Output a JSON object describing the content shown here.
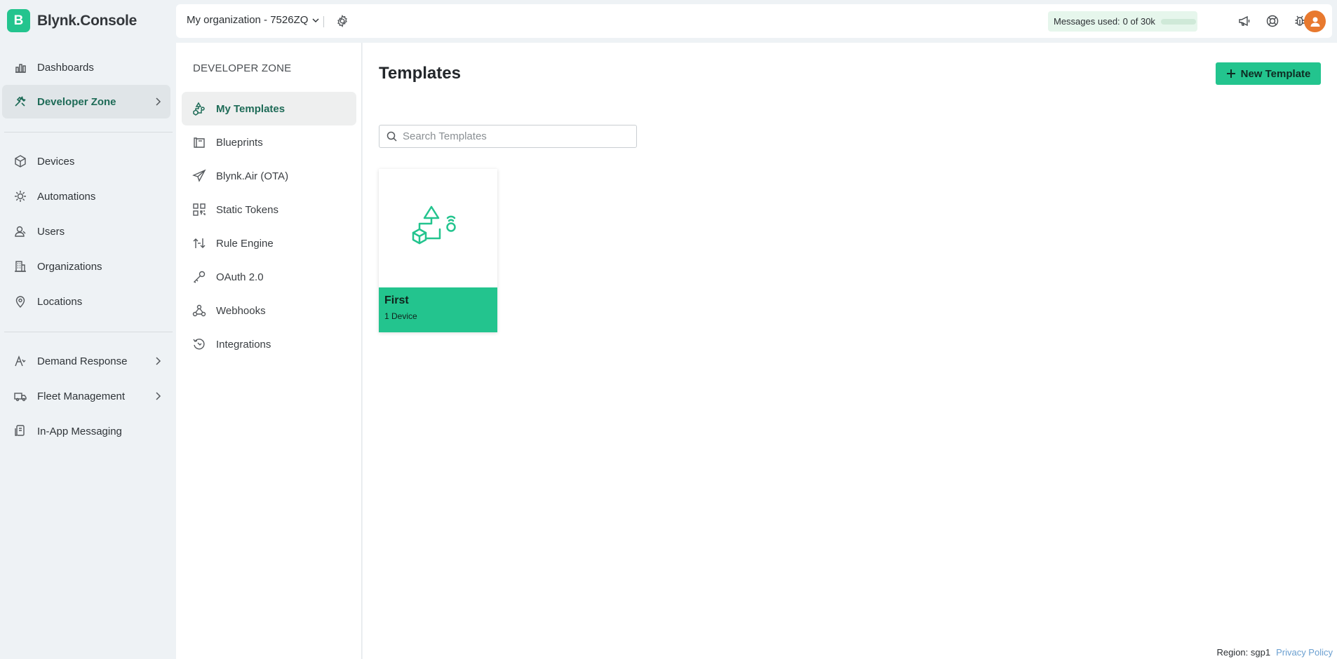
{
  "app": {
    "logo_letter": "B",
    "name": "Blynk.Console",
    "accent": "#23c48e"
  },
  "nav": {
    "dashboards": "Dashboards",
    "developer_zone": "Developer Zone",
    "devices": "Devices",
    "automations": "Automations",
    "users": "Users",
    "organizations": "Organizations",
    "locations": "Locations",
    "demand_response": "Demand Response",
    "fleet_management": "Fleet Management",
    "in_app_messaging": "In-App Messaging"
  },
  "topbar": {
    "org_name": "My organization - 7526ZQ",
    "messages_label": "Messages used:",
    "messages_value": "0 of 30k",
    "messages_used_fraction": 0
  },
  "subnav": {
    "title": "DEVELOPER ZONE",
    "my_templates": "My Templates",
    "blueprints": "Blueprints",
    "blynk_air": "Blynk.Air (OTA)",
    "static_tokens": "Static Tokens",
    "rule_engine": "Rule Engine",
    "oauth": "OAuth 2.0",
    "webhooks": "Webhooks",
    "integrations": "Integrations"
  },
  "main": {
    "title": "Templates",
    "new_button": "New Template",
    "search_placeholder": "Search Templates",
    "templates": [
      {
        "name": "First",
        "count": "1 Device"
      }
    ]
  },
  "footer": {
    "region": "Region: sgp1",
    "privacy": "Privacy Policy"
  }
}
